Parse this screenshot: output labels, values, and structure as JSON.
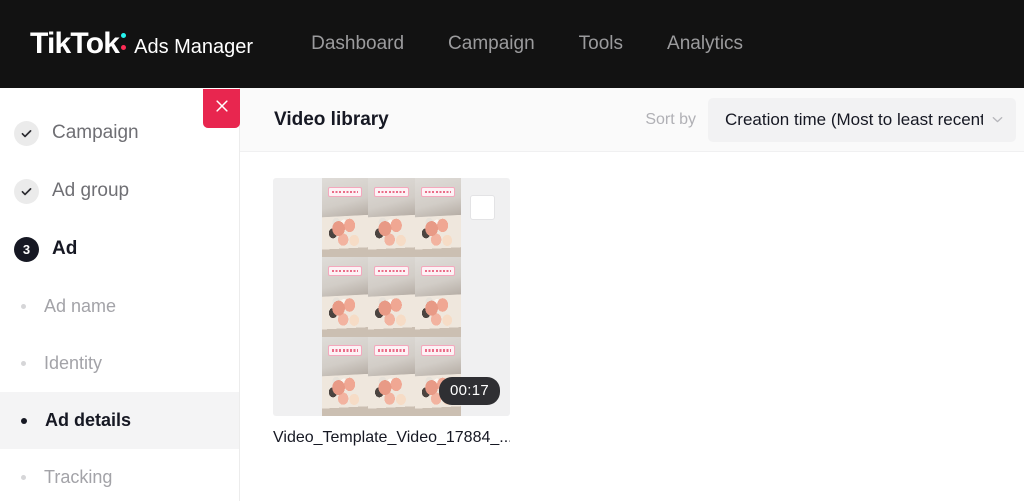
{
  "topnav": {
    "brand_logo": "TikTok",
    "brand_colon_top_color": "#25f4ee",
    "brand_colon_bottom_color": "#fe2c55",
    "brand_sub": "Ads Manager",
    "background": "#121212",
    "links": [
      {
        "label": "Dashboard"
      },
      {
        "label": "Campaign"
      },
      {
        "label": "Tools"
      },
      {
        "label": "Analytics"
      }
    ]
  },
  "sidebar": {
    "steps": [
      {
        "label": "Campaign",
        "state": "done",
        "marker": "check"
      },
      {
        "label": "Ad group",
        "state": "done",
        "marker": "check"
      },
      {
        "label": "Ad",
        "state": "current",
        "marker": "3"
      }
    ],
    "subitems": [
      {
        "label": "Ad name",
        "selected": false
      },
      {
        "label": "Identity",
        "selected": false
      },
      {
        "label": "Ad details",
        "selected": true
      },
      {
        "label": "Tracking",
        "selected": false
      }
    ]
  },
  "close_button": {
    "icon": "close-icon",
    "color": "#e8264f"
  },
  "main": {
    "title": "Video library",
    "sort": {
      "label": "Sort by",
      "value": "Creation time (Most to least recent)",
      "chevron": "chevron-down-icon"
    },
    "videos": [
      {
        "name": "Video_Template_Video_17884_...",
        "duration": "00:17",
        "selected": false,
        "tiles": 9
      }
    ]
  }
}
